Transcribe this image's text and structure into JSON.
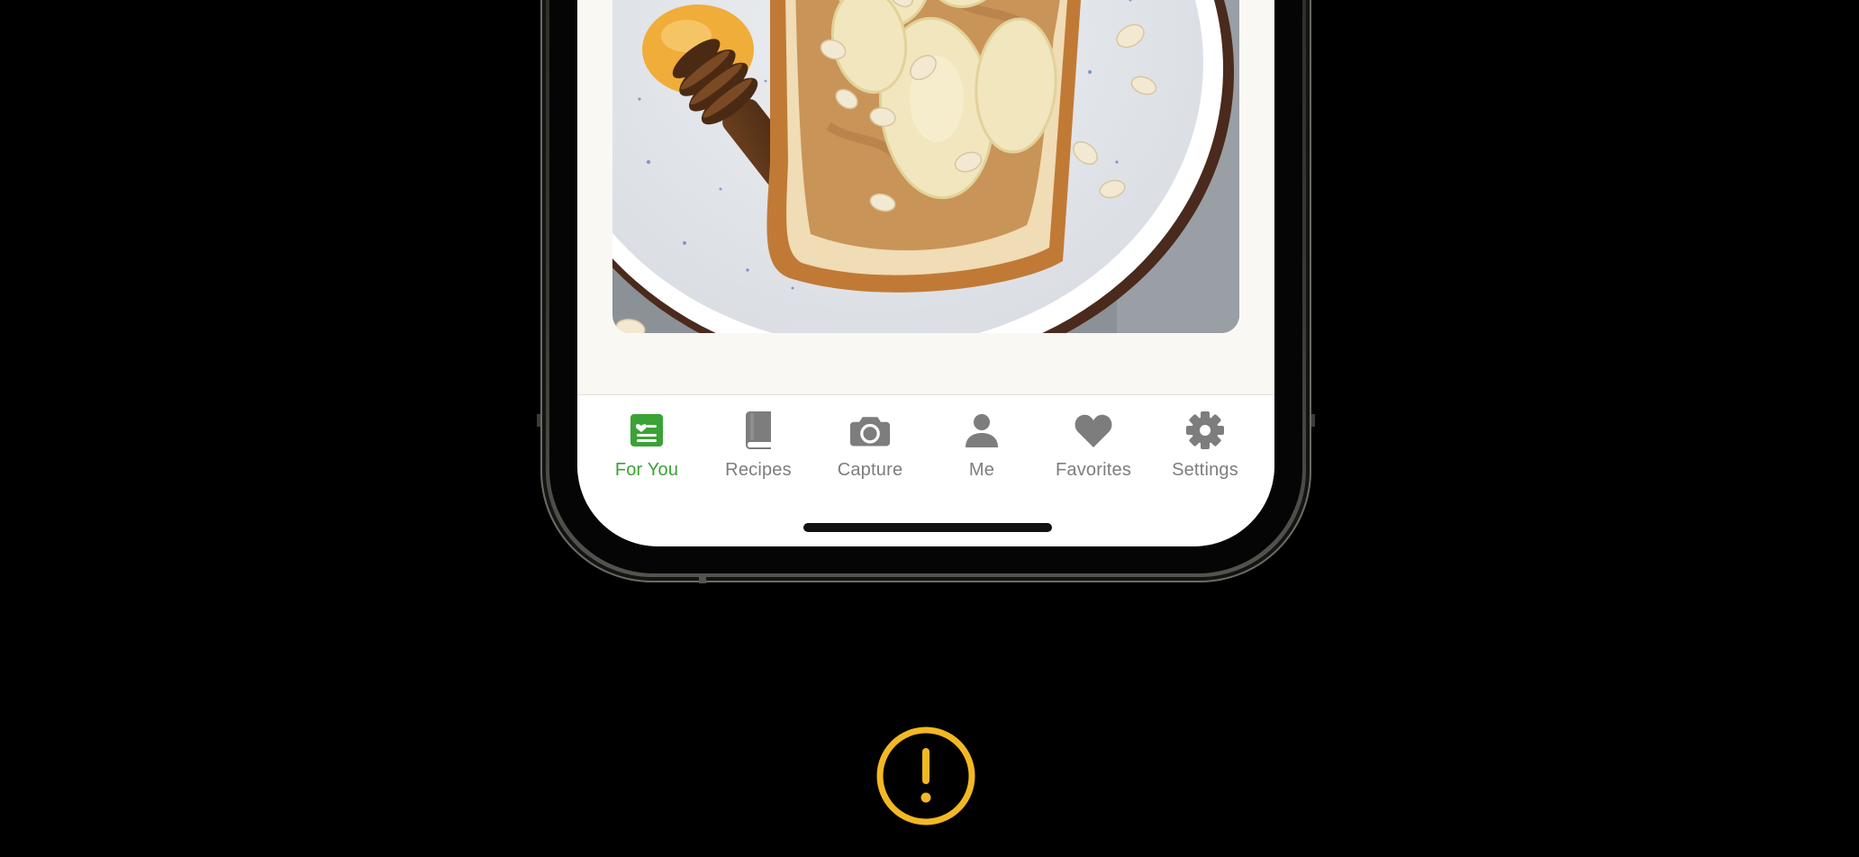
{
  "tab_bar": {
    "active_color": "#3aa335",
    "inactive_color": "#7d7d7d",
    "tabs": [
      {
        "label": "For You",
        "icon": "for-you-icon",
        "active": true
      },
      {
        "label": "Recipes",
        "icon": "book-icon",
        "active": false
      },
      {
        "label": "Capture",
        "icon": "camera-icon",
        "active": false
      },
      {
        "label": "Me",
        "icon": "person-icon",
        "active": false
      },
      {
        "label": "Favorites",
        "icon": "heart-icon",
        "active": false
      },
      {
        "label": "Settings",
        "icon": "gear-icon",
        "active": false
      }
    ]
  },
  "content": {
    "image": "peanut-butter-banana-toast-photo"
  },
  "alert": {
    "icon": "exclamation-circle-icon",
    "color": "#f2b824"
  }
}
